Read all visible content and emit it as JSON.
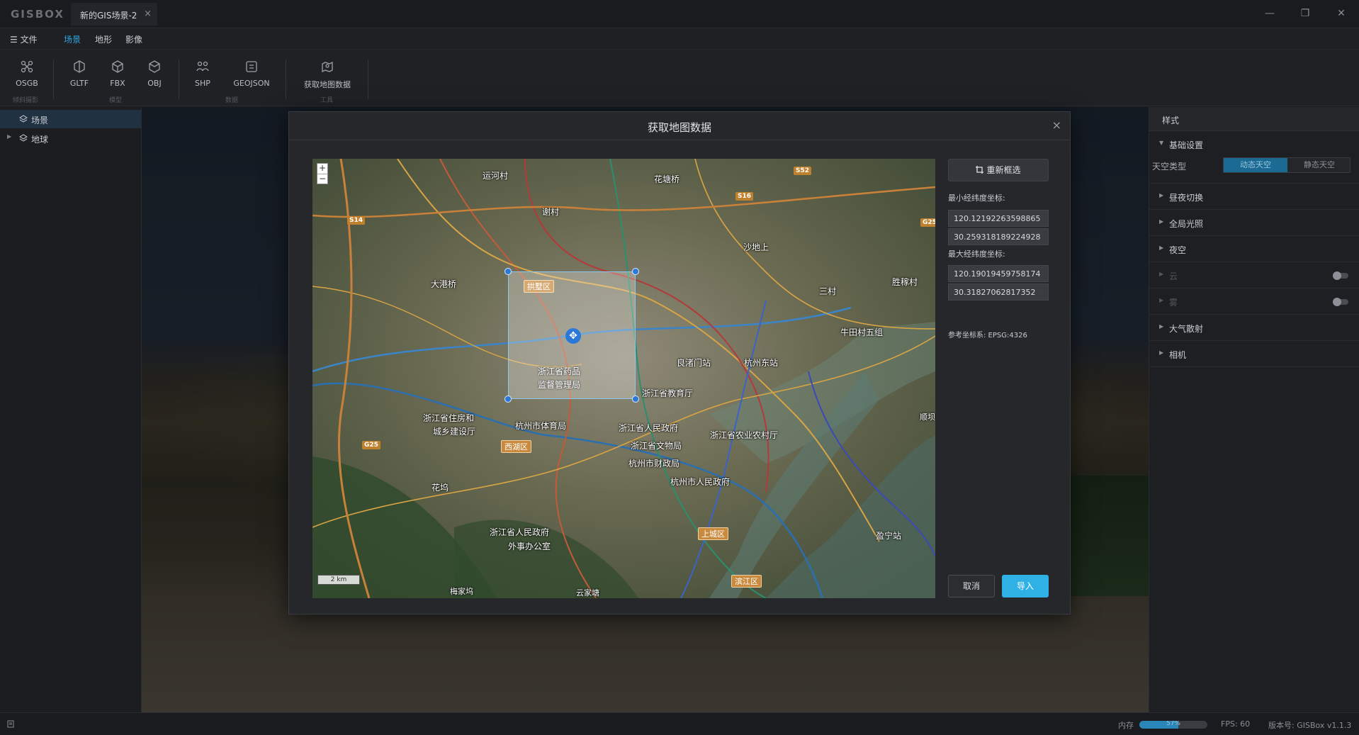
{
  "app": {
    "logo": "GISBOX"
  },
  "tabs": [
    {
      "label": "新的GIS场景-2",
      "close": "×"
    }
  ],
  "window_controls": {
    "minimize": "—",
    "restore": "❐",
    "close": "✕"
  },
  "menu": {
    "file": "☰ 文件",
    "items": [
      {
        "label": "场景",
        "active": true
      },
      {
        "label": "地形"
      },
      {
        "label": "影像"
      }
    ]
  },
  "ribbon": {
    "buttons": [
      {
        "label": "OSGB",
        "icon": "osgb-icon"
      },
      {
        "label": "GLTF",
        "icon": "gltf-icon"
      },
      {
        "label": "FBX",
        "icon": "fbx-icon"
      },
      {
        "label": "OBJ",
        "icon": "obj-icon"
      },
      {
        "label": "SHP",
        "icon": "shp-icon"
      },
      {
        "label": "GEOJSON",
        "icon": "geojson-icon"
      },
      {
        "label": "获取地图数据",
        "icon": "map-data-icon"
      }
    ],
    "groups": [
      "倾斜摄影",
      "模型",
      "数据",
      "工具"
    ]
  },
  "tree": {
    "items": [
      {
        "label": "场景",
        "selected": true
      },
      {
        "label": "地球"
      }
    ]
  },
  "right_panel": {
    "tab": "样式",
    "sections": [
      "基础设置",
      "昼夜切换",
      "全局光照",
      "夜空",
      "云",
      "雾",
      "大气散射",
      "相机"
    ],
    "sky_type_label": "天空类型",
    "sky_options": [
      "动态天空",
      "静态天空"
    ],
    "toggles": {
      "cloud": false,
      "fog": false
    }
  },
  "dialog": {
    "title": "获取地图数据",
    "close": "×",
    "reselect_button": "重新框选",
    "min_label": "最小经纬度坐标:",
    "min_lon": "120.12192263598865",
    "min_lat": "30.259318189224928",
    "max_label": "最大经纬度坐标:",
    "max_lon": "120.19019459758174",
    "max_lat": "30.31827062817352",
    "crs": "参考坐标系: EPSG:4326",
    "cancel": "取消",
    "import": "导入"
  },
  "map": {
    "zoom_in": "+",
    "zoom_out": "−",
    "scale": "2 km",
    "move_icon": "✥",
    "labels": [
      "运河村",
      "花塘桥",
      "谢村",
      "沙地上",
      "大港桥",
      "三村",
      "胜稼村",
      "浙江省药品",
      "监督管理局",
      "浙江省教育厅",
      "牛田村五组",
      "浙江省住房和",
      "城乡建设厅",
      "杭州市体育局",
      "浙江省人民政府",
      "浙江省文物局",
      "浙江省农业农村厅",
      "杭州市财政局",
      "杭州市人民政府",
      "花坞",
      "浙江省人民政府",
      "外事办公室",
      "梅家坞",
      "云家塘",
      "顺坝",
      "良渚门站",
      "杭州东站",
      "盈宁站"
    ],
    "badges": [
      "拱墅区",
      "西湖区",
      "上城区",
      "滨江区"
    ],
    "shields": [
      "S14",
      "S16",
      "S52",
      "G25",
      "G25"
    ]
  },
  "status": {
    "memory_label": "内存",
    "memory_percent": 57,
    "memory_text": "57%",
    "fps": "FPS: 60",
    "version": "版本号: GISBox v1.1.3"
  },
  "colors": {
    "accent": "#2fa3e2",
    "import_button": "#2fb1e6",
    "selection": "#2a79d9"
  }
}
